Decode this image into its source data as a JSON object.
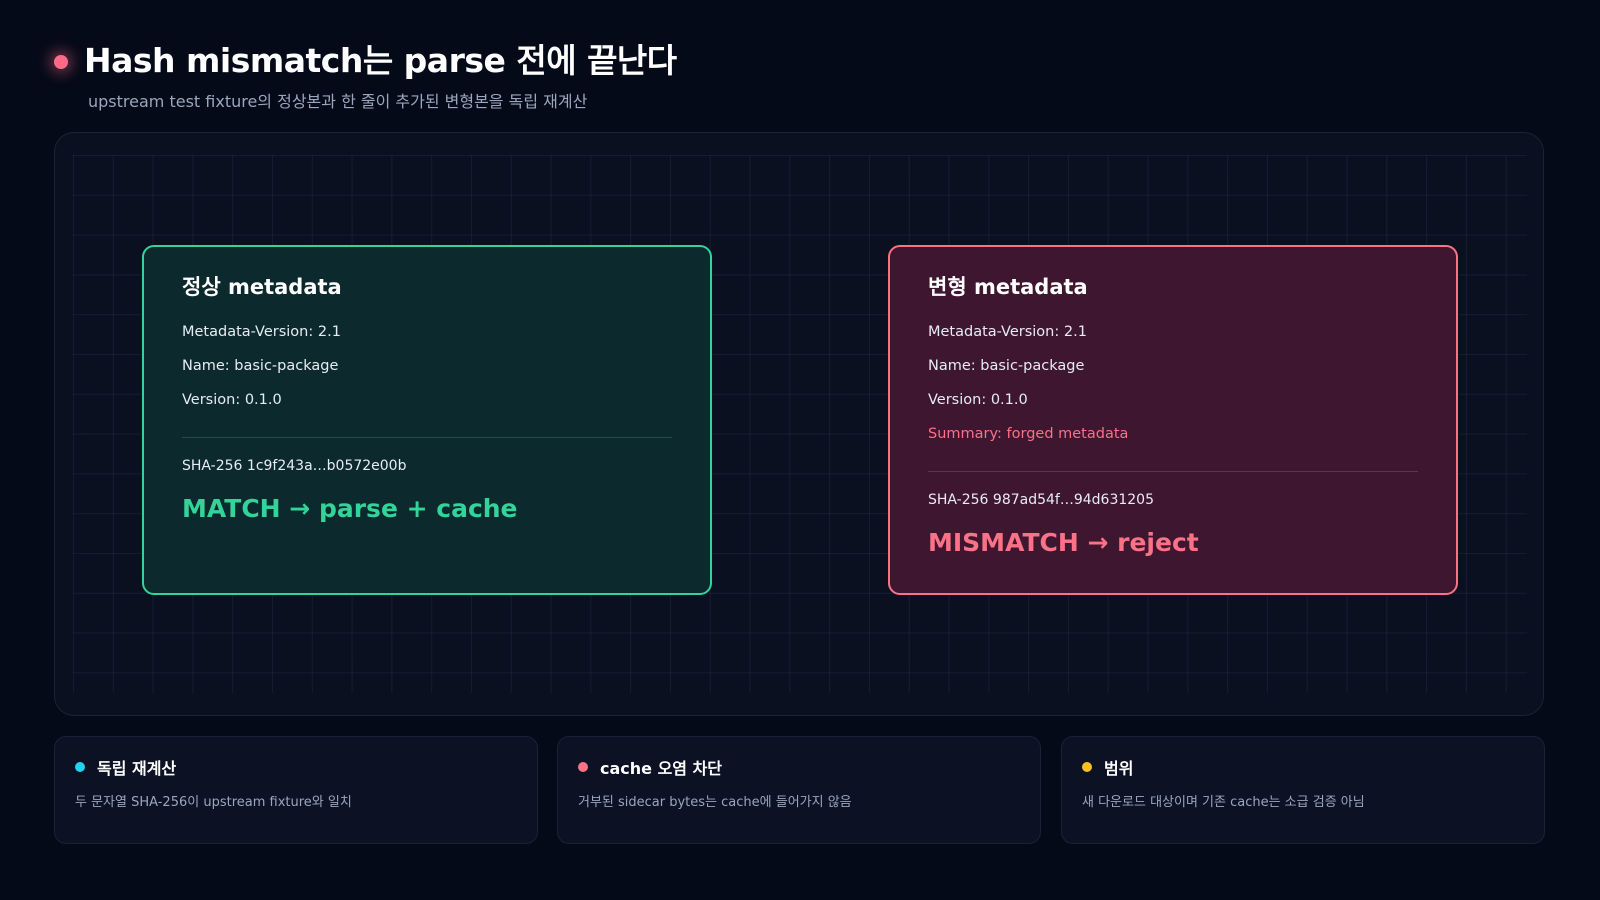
{
  "header": {
    "title": "Hash mismatch는 parse 전에 끝난다",
    "subtitle": "upstream test fixture의 정상본과 한 줄이 추가된 변형본을 독립 재계산",
    "accent_color": "#ff6b86"
  },
  "cards": {
    "normal": {
      "title": "정상 metadata",
      "lines": [
        "Metadata-Version: 2.1",
        "Name: basic-package",
        "Version: 0.1.0"
      ],
      "sha": "SHA-256 1c9f243a…b0572e00b",
      "verdict": "MATCH → parse + cache",
      "color": "#34d399"
    },
    "forged": {
      "title": "변형 metadata",
      "lines": [
        "Metadata-Version: 2.1",
        "Name: basic-package",
        "Version: 0.1.0"
      ],
      "extra_line": "Summary: forged metadata",
      "sha": "SHA-256 987ad54f…94d631205",
      "verdict": "MISMATCH → reject",
      "color": "#fb7185"
    }
  },
  "notes": [
    {
      "title": "독립 재계산",
      "body": "두 문자열 SHA-256이 upstream fixture와 일치",
      "dot_color": "#22d3ee"
    },
    {
      "title": "cache 오염 차단",
      "body": "거부된 sidecar bytes는 cache에 들어가지 않음",
      "dot_color": "#fb7185"
    },
    {
      "title": "범위",
      "body": "새 다운로드 대상이며 기존 cache는 소급 검증 아님",
      "dot_color": "#fbbf24"
    }
  ]
}
